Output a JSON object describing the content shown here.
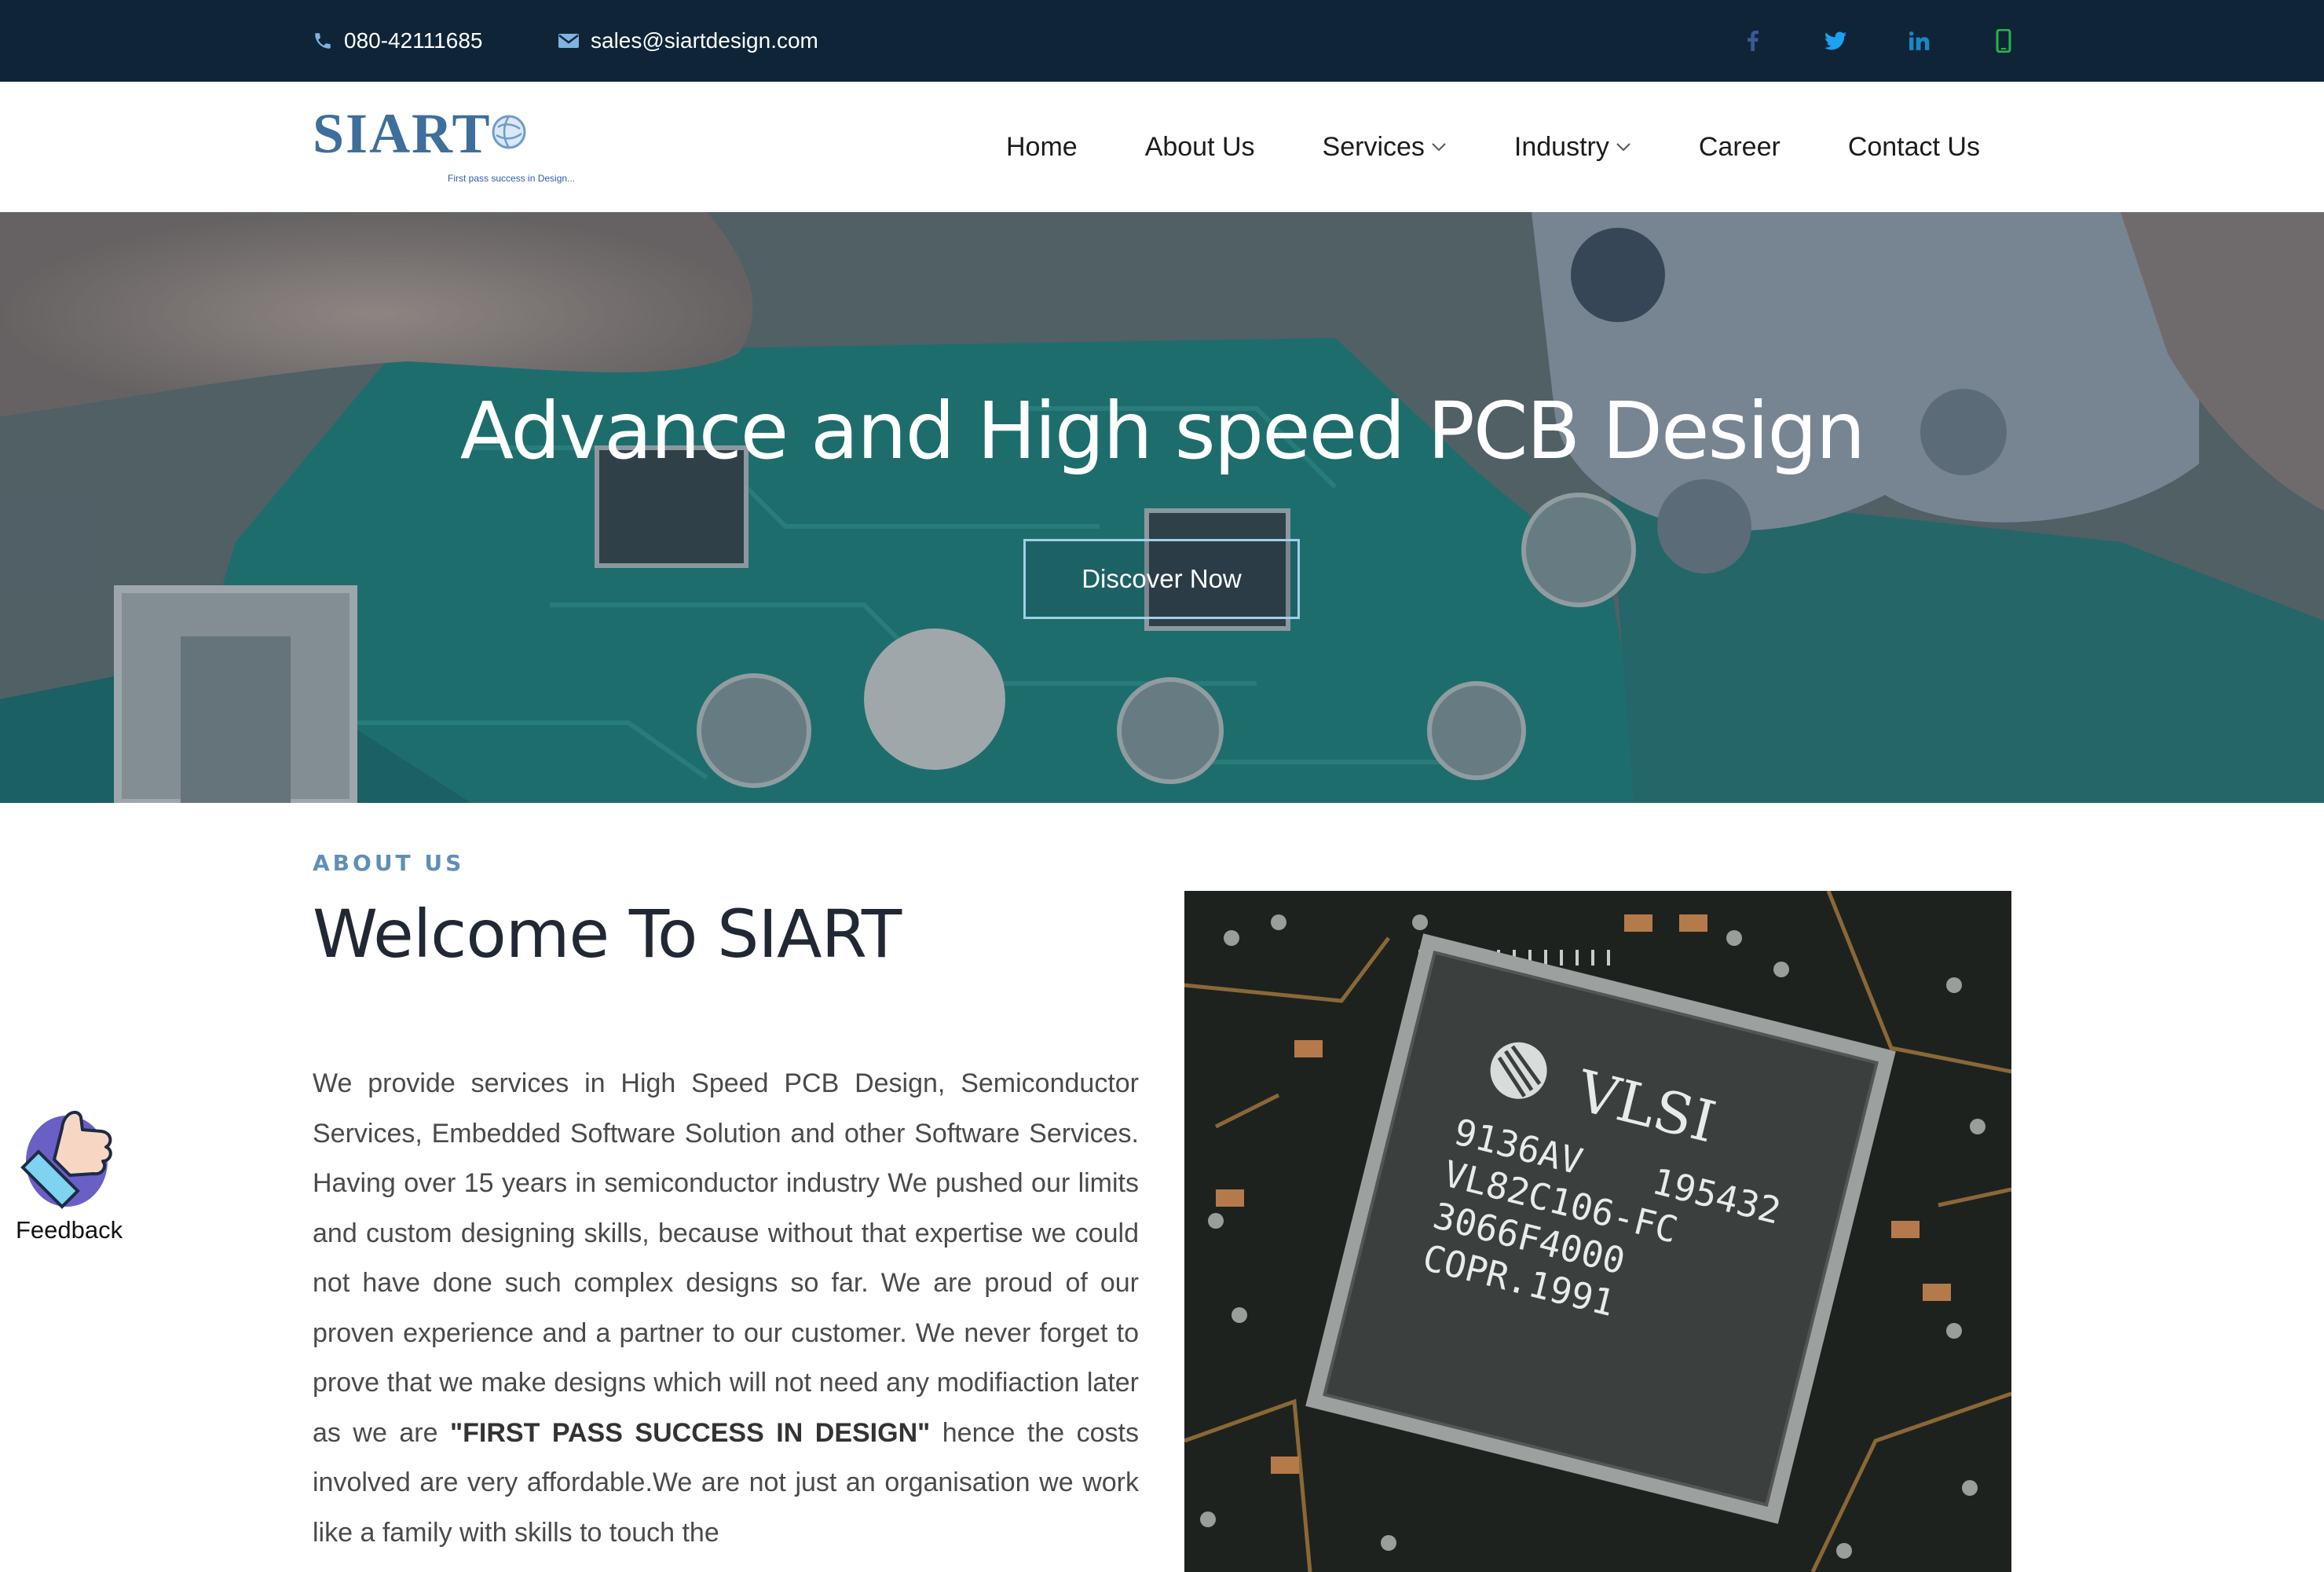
{
  "topbar": {
    "phone": "080-42111685",
    "email": "sales@siartdesign.com",
    "social": [
      {
        "icon": "facebook-icon",
        "color": "#3b5998"
      },
      {
        "icon": "twitter-icon",
        "color": "#1da1f2"
      },
      {
        "icon": "linkedin-icon",
        "color": "#0e76a8"
      },
      {
        "icon": "mobile-icon",
        "color": "#2bb24c"
      }
    ]
  },
  "header": {
    "logo_text": "SIART",
    "logo_tagline": "First pass success in Design...",
    "nav": [
      {
        "label": "Home",
        "dropdown": false
      },
      {
        "label": "About Us",
        "dropdown": false
      },
      {
        "label": "Services",
        "dropdown": true
      },
      {
        "label": "Industry",
        "dropdown": true
      },
      {
        "label": "Career",
        "dropdown": false
      },
      {
        "label": "Contact Us",
        "dropdown": false
      }
    ]
  },
  "hero": {
    "title": "Advance and High speed PCB Design",
    "button": "Discover Now"
  },
  "about": {
    "label": "ABOUT US",
    "title": "Welcome To SIART",
    "text_before": "We provide services in High Speed PCB Design, Semiconductor Services, Embedded Software Solution and other Software Services. Having over 15 years in semiconductor industry We pushed our limits and custom designing skills, because without that expertise we could not have done such complex designs so far. We are proud of our proven experience and a partner to our customer. We never forget to prove that we make designs which will not need any modifiaction later as we are ",
    "text_bold": "\"FIRST PASS SUCCESS IN DESIGN\"",
    "text_after": " hence the costs involved are very affordable.We are not just an organisation we work like a family with skills to touch the",
    "chip_labels": [
      "VLSI",
      "9136AV",
      "195432",
      "VL82C106-FC",
      "3066F4000",
      "COPR.1991"
    ]
  },
  "feedback": {
    "label": "Feedback"
  }
}
